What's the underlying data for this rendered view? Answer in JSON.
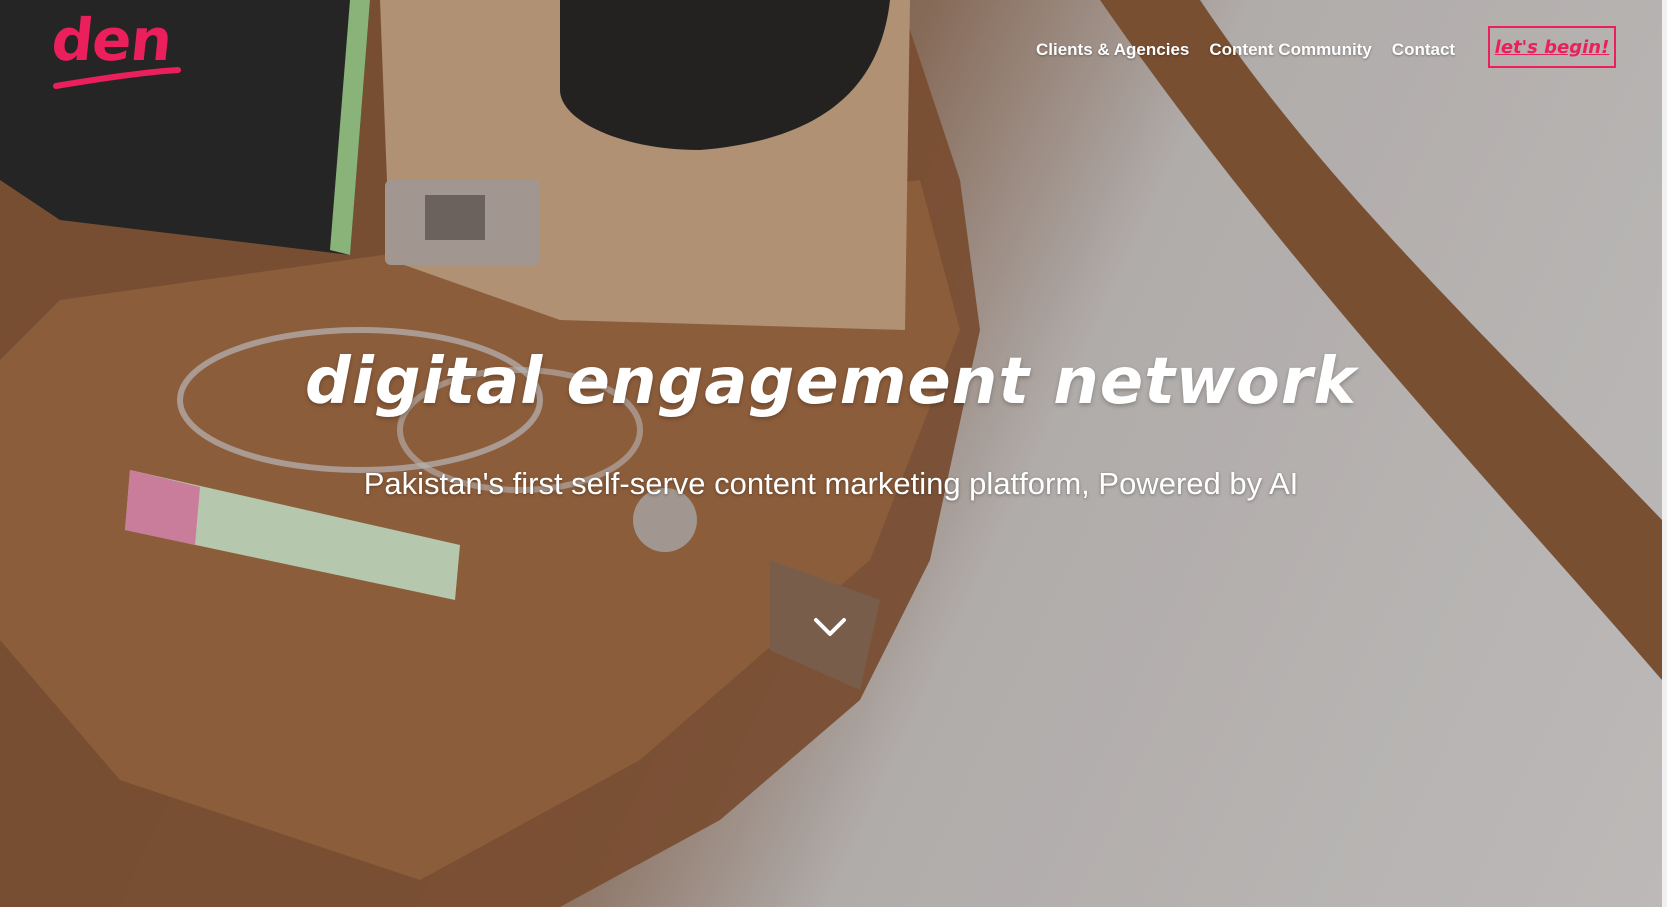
{
  "header": {
    "logo_text": "den",
    "nav": [
      {
        "label": "Clients & Agencies"
      },
      {
        "label": "Content Community"
      },
      {
        "label": "Contact"
      }
    ],
    "cta_label": "let's begin!"
  },
  "hero": {
    "headline": "digital engagement network",
    "subline": "Pakistan's first self-serve content marketing platform, Powered by AI",
    "background_image": "leather-bag-with-phone-glasses-pen-icon",
    "scroll_icon": "chevron-down-icon"
  },
  "colors": {
    "brand": "#ea1f5b",
    "text_on_hero": "#ffffff"
  }
}
